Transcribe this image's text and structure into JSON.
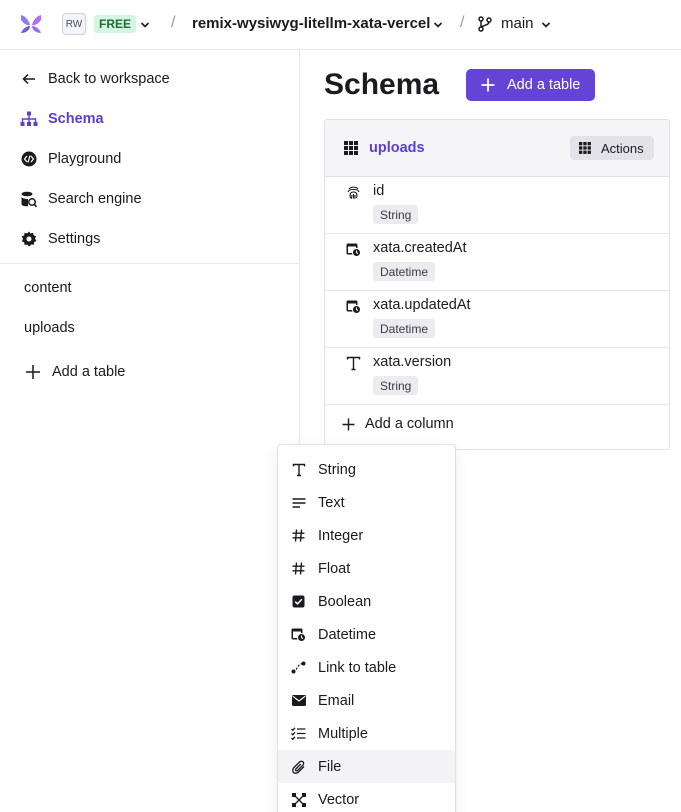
{
  "topbar": {
    "workspace_initials": "RW",
    "plan": "FREE",
    "separator": "/",
    "database": "remix-wysiwyg-litellm-xata-vercel",
    "branch": "main"
  },
  "sidebar": {
    "back_label": "Back to workspace",
    "items": [
      {
        "label": "Schema",
        "icon": "sitemap-icon",
        "active": true
      },
      {
        "label": "Playground",
        "icon": "code-icon",
        "active": false
      },
      {
        "label": "Search engine",
        "icon": "search-database-icon",
        "active": false
      },
      {
        "label": "Settings",
        "icon": "gear-icon",
        "active": false
      }
    ],
    "tables": [
      "content",
      "uploads"
    ],
    "add_table_label": "Add a table"
  },
  "main": {
    "title": "Schema",
    "add_table_button": "Add a table",
    "table": {
      "name": "uploads",
      "actions_label": "Actions",
      "columns": [
        {
          "name": "id",
          "type": "String",
          "icon": "fingerprint-icon"
        },
        {
          "name": "xata.createdAt",
          "type": "Datetime",
          "icon": "calendar-clock-icon"
        },
        {
          "name": "xata.updatedAt",
          "type": "Datetime",
          "icon": "calendar-clock-icon"
        },
        {
          "name": "xata.version",
          "type": "String",
          "icon": "text-type-icon"
        }
      ],
      "add_column_label": "Add a column"
    }
  },
  "type_menu": {
    "items": [
      {
        "label": "String",
        "icon": "text-type-icon"
      },
      {
        "label": "Text",
        "icon": "text-lines-icon"
      },
      {
        "label": "Integer",
        "icon": "hash-icon"
      },
      {
        "label": "Float",
        "icon": "hash-icon"
      },
      {
        "label": "Boolean",
        "icon": "checkbox-icon"
      },
      {
        "label": "Datetime",
        "icon": "calendar-clock-icon"
      },
      {
        "label": "Link to table",
        "icon": "link-icon"
      },
      {
        "label": "Email",
        "icon": "envelope-icon"
      },
      {
        "label": "Multiple",
        "icon": "checklist-icon"
      },
      {
        "label": "File",
        "icon": "paperclip-icon"
      },
      {
        "label": "Vector",
        "icon": "vector-icon"
      }
    ],
    "highlighted": "File"
  },
  "colors": {
    "accent": "#6344d6",
    "accent_text": "#5a3fd1",
    "plan_badge_bg": "#d6f5e1",
    "border": "#e1e1e8"
  }
}
